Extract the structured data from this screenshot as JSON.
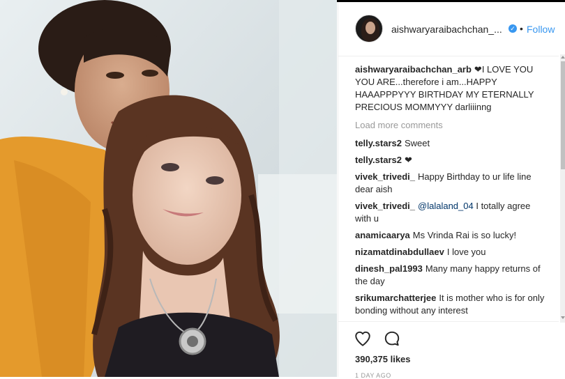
{
  "post": {
    "username": "aishwaryaraibachchan_...",
    "verified_glyph": "✓",
    "separator": "•",
    "follow_label": "Follow",
    "caption": {
      "user": "aishwaryaraibachchan_arb",
      "text": "❤I LOVE YOU YOU ARE...therefore i am...HAPPY HAAAPPPYYY BIRTHDAY MY ETERNALLY PRECIOUS MOMMYYY darliiinng"
    },
    "load_more": "Load more comments",
    "comments": [
      {
        "user": "telly.stars2",
        "text": "Sweet"
      },
      {
        "user": "telly.stars2",
        "text": "❤"
      },
      {
        "user": "vivek_trivedi_",
        "text": "Happy Birthday to ur life line dear aish"
      },
      {
        "user": "vivek_trivedi_",
        "mention": "@lalaland_04",
        "text": "I totally agree with u"
      },
      {
        "user": "anamicaarya",
        "text": "Ms Vrinda Rai is so lucky!"
      },
      {
        "user": "nizamatdinabdullaev",
        "text": "I love you"
      },
      {
        "user": "dinesh_pal1993",
        "text": "Many many happy returns of the day"
      },
      {
        "user": "srikumarchatterjee",
        "text": "It is mother who is for only bonding without any interest"
      }
    ],
    "likes": "390,375 likes",
    "time": "1 DAY AGO",
    "icons": {
      "like": "heart-outline-icon",
      "comment": "comment-bubble-icon",
      "verified": "verified-badge-icon"
    },
    "colors": {
      "link": "#3897f0",
      "muted": "#999999",
      "text": "#262626"
    }
  }
}
